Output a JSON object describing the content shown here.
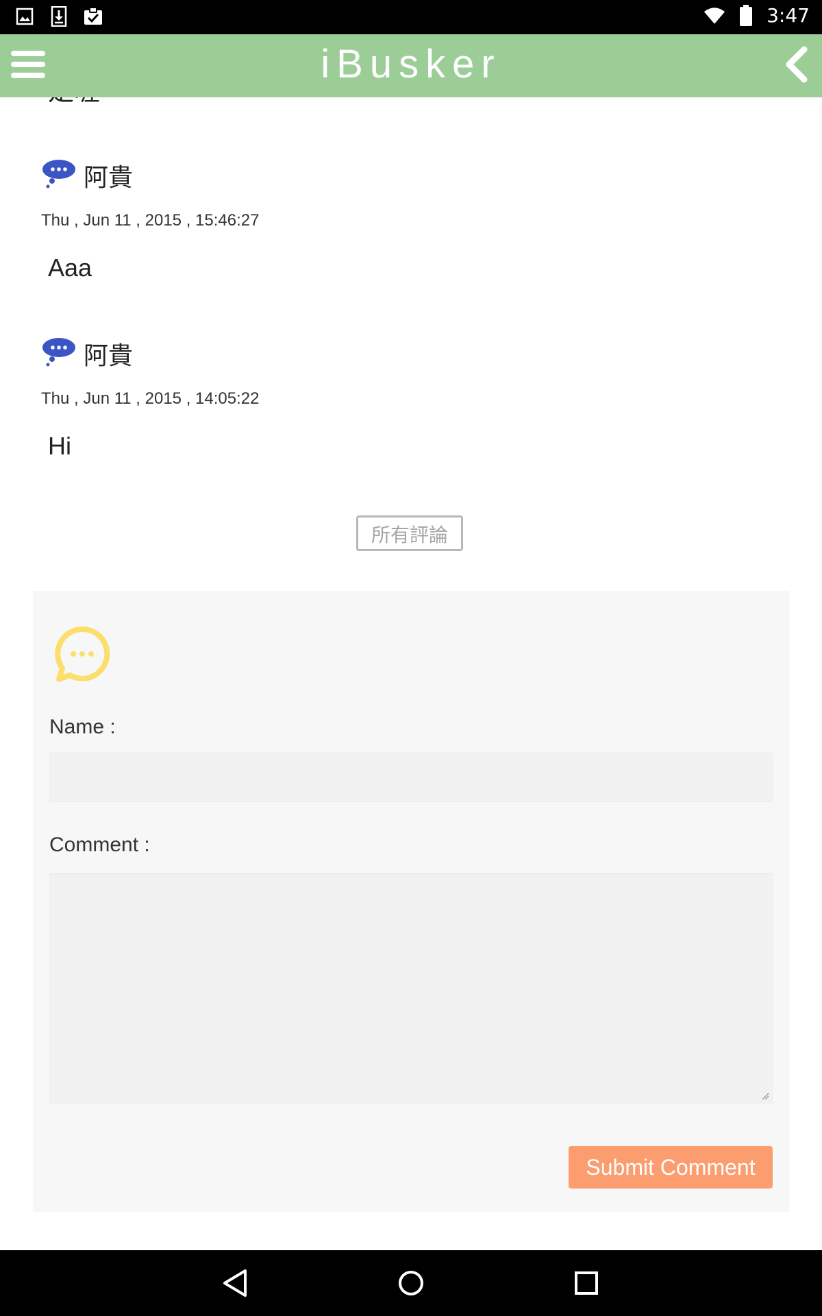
{
  "status_bar": {
    "time": "3:47",
    "left_icons": [
      "image-icon",
      "download-icon",
      "clipboard-check-icon"
    ],
    "right_icons": [
      "wifi-icon",
      "battery-icon"
    ]
  },
  "app_bar": {
    "title": "iBusker",
    "menu_icon": "hamburger-menu-icon",
    "back_icon": "chevron-left-icon",
    "color": "#9ccd97"
  },
  "partial_text": "是喔",
  "comments": [
    {
      "author": "阿貴",
      "date": "Thu , Jun 11 , 2015 , 15:46:27",
      "text": "Aaa"
    },
    {
      "author": "阿貴",
      "date": "Thu , Jun 11 , 2015 , 14:05:22",
      "text": "Hi"
    }
  ],
  "all_comments_label": "所有評論",
  "form": {
    "name_label": "Name :",
    "name_value": "",
    "comment_label": "Comment :",
    "comment_value": "",
    "submit_label": "Submit Comment",
    "submit_color": "#fc9d70",
    "icon_color": "#fbde6c"
  },
  "nav_bar": [
    "back-triangle-icon",
    "home-circle-icon",
    "recents-square-icon"
  ]
}
